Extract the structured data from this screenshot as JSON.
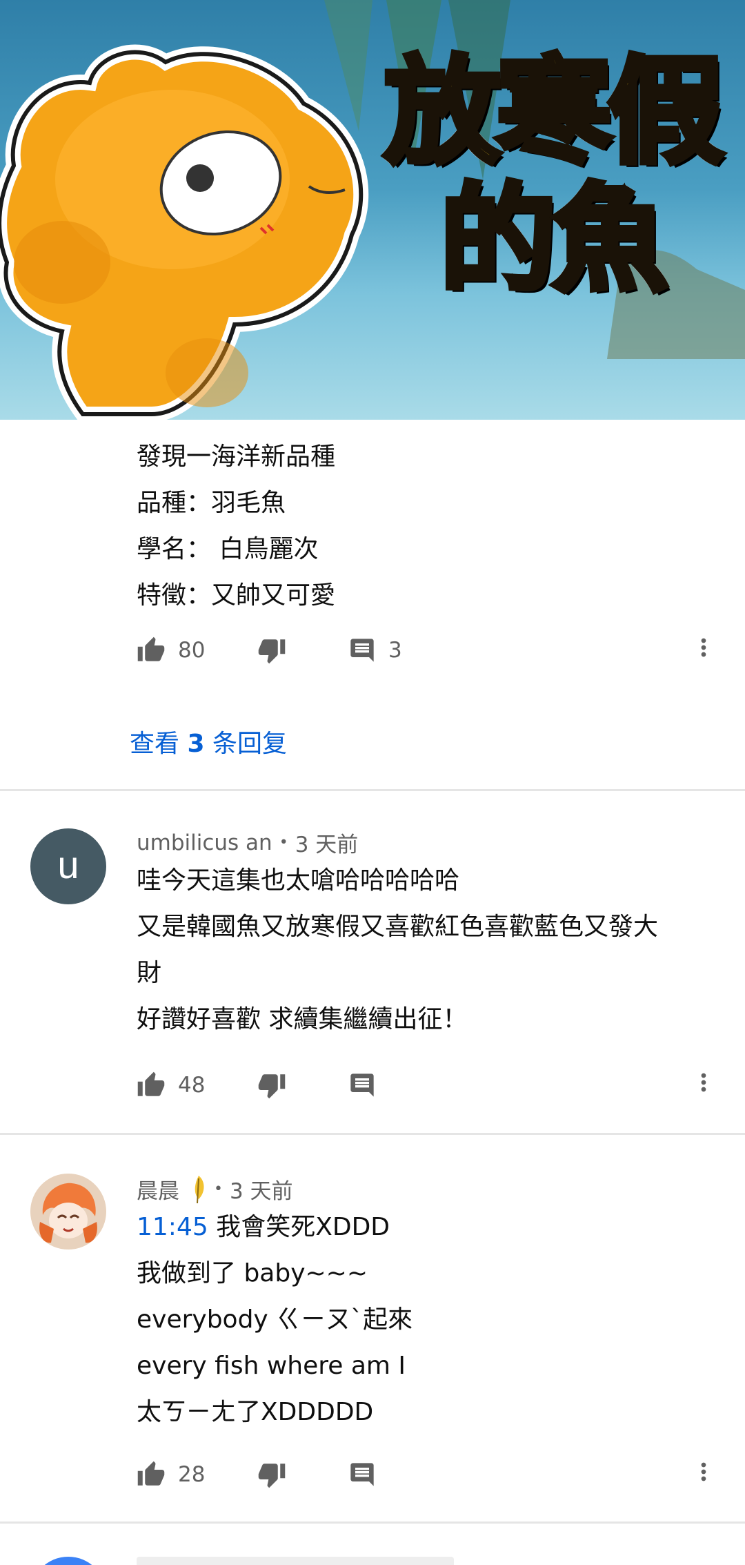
{
  "video": {
    "thumbnail_title_lines": [
      "放寒假",
      "的魚"
    ]
  },
  "comments": [
    {
      "lines": [
        "發現一海洋新品種",
        "品種：羽毛魚",
        "學名： 白鳥麗次",
        "特徵：又帥又可愛"
      ],
      "likes": "80",
      "replies_count": "3",
      "view_replies_prefix": "查看 ",
      "view_replies_count": "3",
      "view_replies_suffix": " 条回复"
    },
    {
      "avatar_letter": "u",
      "author": "umbilicus an",
      "time": "3 天前",
      "lines": [
        "哇今天這集也太嗆哈哈哈哈哈",
        "又是韓國魚又放寒假又喜歡紅色喜歡藍色又發大",
        "財",
        "好讚好喜歡  求續集繼續出征！"
      ],
      "likes": "48"
    },
    {
      "author": "晨晨",
      "time": "3 天前",
      "timestamp_link": "11:45",
      "first_line_rest": " 我會笑死XDDD",
      "lines": [
        "我做到了 baby~~~",
        "everybody ㄍㄧㄡˋ起來",
        "every fish where am I",
        "太ㄎㄧㄤ了XDDDDD"
      ],
      "likes": "28"
    }
  ],
  "colors": {
    "link": "#065fd4",
    "meta_text": "#606060",
    "avatar_bg": "#455a64",
    "divider": "#e5e5e5"
  },
  "icons": [
    "like-icon",
    "dislike-icon",
    "reply-icon",
    "more-vert-icon",
    "feather-badge-icon"
  ]
}
